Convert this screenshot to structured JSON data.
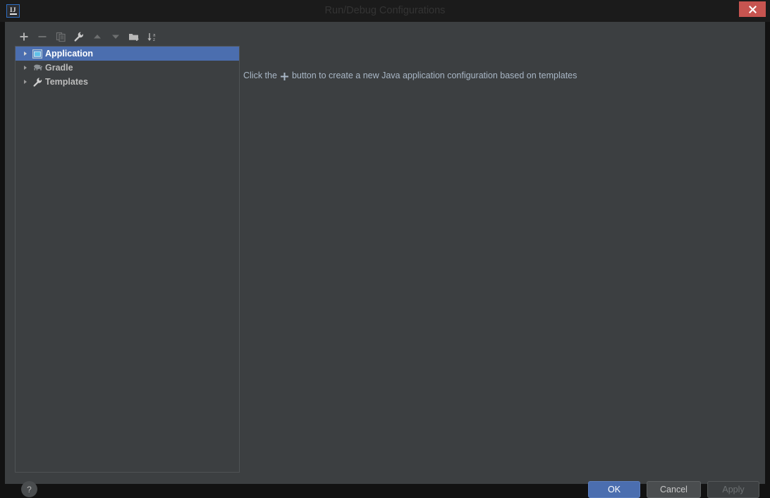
{
  "window": {
    "title": "Run/Debug Configurations",
    "app_icon_label": "IJ",
    "close_icon": "close-icon"
  },
  "colors": {
    "dialog_background": "#3c3f41",
    "titlebar_background": "#1b1b1b",
    "selection_blue": "#4b6eaf",
    "close_red": "#c75450",
    "text_primary": "#bbbbbb",
    "text_hint": "#a9b7c6",
    "border": "#4f5355"
  },
  "toolbar": {
    "buttons": [
      {
        "name": "add-configuration-button",
        "icon": "plus-icon",
        "label": "Add New Configuration",
        "enabled": true
      },
      {
        "name": "remove-configuration-button",
        "icon": "minus-icon",
        "label": "Remove Configuration",
        "enabled": false
      },
      {
        "name": "copy-configuration-button",
        "icon": "copy-icon",
        "label": "Copy Configuration",
        "enabled": false
      },
      {
        "name": "edit-templates-button",
        "icon": "wrench-icon",
        "label": "Edit Templates",
        "enabled": true
      },
      {
        "name": "move-up-button",
        "icon": "arrow-up-icon",
        "label": "Move Up",
        "enabled": false
      },
      {
        "name": "move-down-button",
        "icon": "arrow-down-icon",
        "label": "Move Down",
        "enabled": false
      },
      {
        "name": "create-folder-button",
        "icon": "folder-add-icon",
        "label": "Create New Folder",
        "enabled": true
      },
      {
        "name": "sort-configurations-button",
        "icon": "sort-alpha-icon",
        "label": "Sort Configurations",
        "enabled": true
      }
    ]
  },
  "tree": {
    "items": [
      {
        "label": "Application",
        "icon": "application-window-icon",
        "expander": "collapsed",
        "selected": true
      },
      {
        "label": "Gradle",
        "icon": "gradle-elephant-icon",
        "expander": "collapsed",
        "selected": false
      },
      {
        "label": "Templates",
        "icon": "wrench-icon",
        "expander": "collapsed",
        "selected": false
      }
    ]
  },
  "main": {
    "hint_prefix": "Click the",
    "hint_suffix": "button to create a new Java application configuration based on templates"
  },
  "footer": {
    "help_label": "?",
    "ok_label": "OK",
    "cancel_label": "Cancel",
    "apply_label": "Apply"
  }
}
